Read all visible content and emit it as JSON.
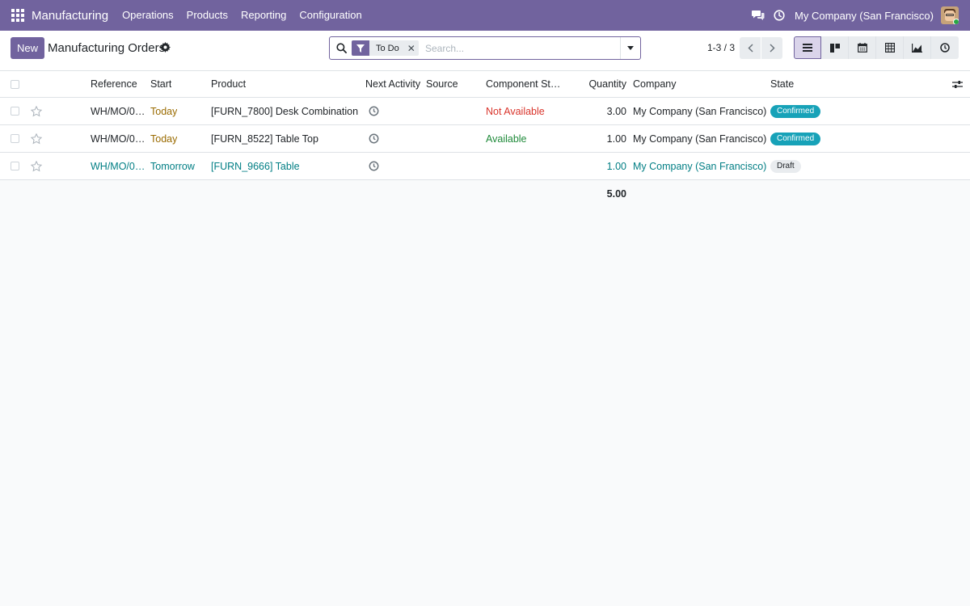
{
  "navbar": {
    "brand": "Manufacturing",
    "menu": [
      "Operations",
      "Products",
      "Reporting",
      "Configuration"
    ],
    "company": "My Company (San Francisco)"
  },
  "control": {
    "new_label": "New",
    "title": "Manufacturing Orders",
    "facet_label": "To Do",
    "search_placeholder": "Search...",
    "pager": "1-3 / 3"
  },
  "table": {
    "headers": {
      "reference": "Reference",
      "start": "Start",
      "product": "Product",
      "activity": "Next Activity",
      "source": "Source",
      "component": "Component St…",
      "quantity": "Quantity",
      "company": "Company",
      "state": "State"
    },
    "rows": [
      {
        "reference": "WH/MO/0…",
        "start": "Today",
        "product": "[FURN_7800] Desk Combination",
        "component": "Not Available",
        "quantity": "3.00",
        "company": "My Company (San Francisco)",
        "state": "Confirmed"
      },
      {
        "reference": "WH/MO/0…",
        "start": "Today",
        "product": "[FURN_8522] Table Top",
        "component": "Available",
        "quantity": "1.00",
        "company": "My Company (San Francisco)",
        "state": "Confirmed"
      },
      {
        "reference": "WH/MO/0…",
        "start": "Tomorrow",
        "product": "[FURN_9666] Table",
        "component": "",
        "quantity": "1.00",
        "company": "My Company (San Francisco)",
        "state": "Draft"
      }
    ],
    "total_quantity": "5.00"
  },
  "colors": {
    "brand": "#71639e",
    "badge_confirmed": "#17a2b8",
    "not_available": "#d9342b",
    "available": "#1f8a3a",
    "link": "#017e84"
  }
}
